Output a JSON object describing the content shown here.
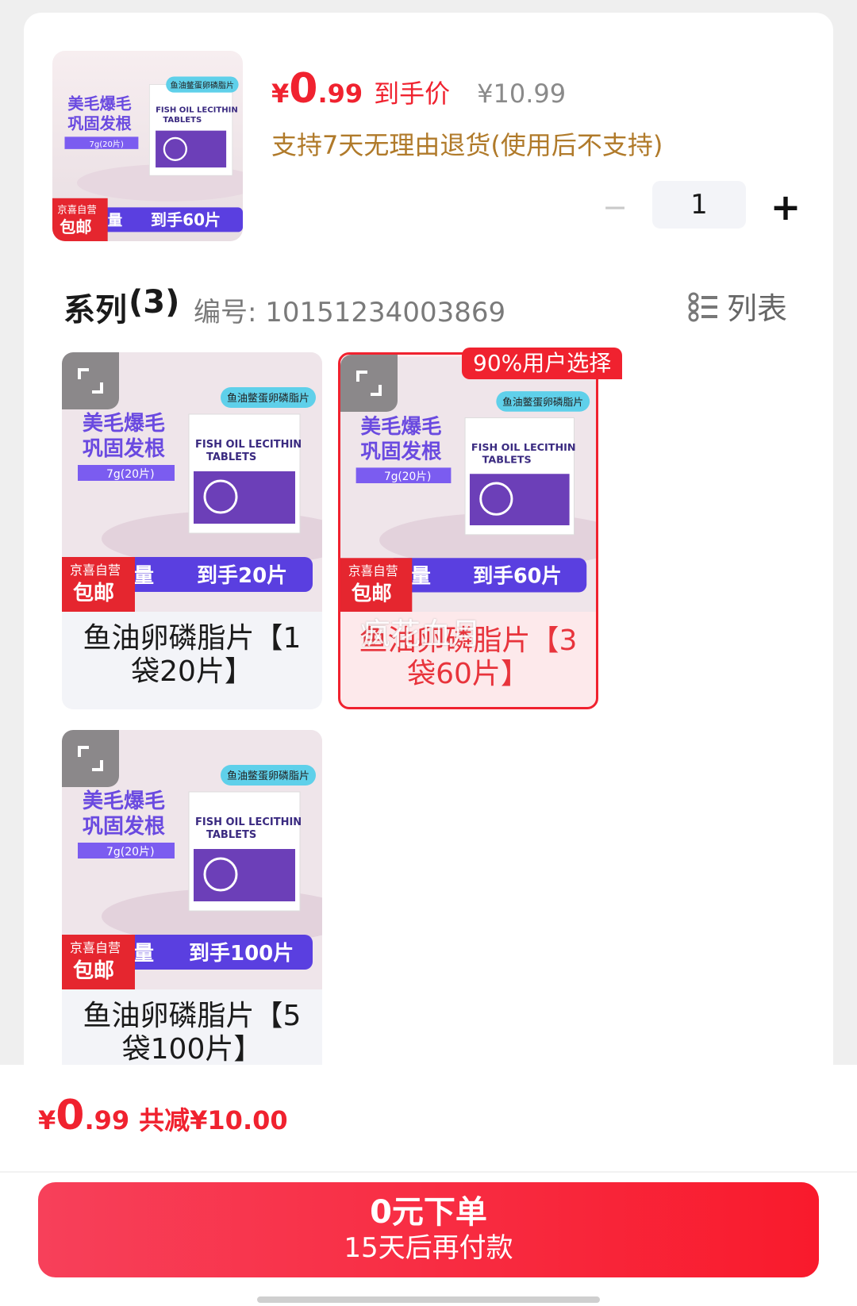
{
  "product": {
    "price_currency": "¥",
    "price_int": "0",
    "price_dec": ".99",
    "price_label": "到手价",
    "original_price": "¥10.99",
    "return_policy": "支持7天无理由退货(使用后不支持)"
  },
  "stepper": {
    "minus": "−",
    "value": "1",
    "plus": "+"
  },
  "series": {
    "title": "系列",
    "count": "(3)",
    "sku_label": "编号: 10151234003869",
    "view_toggle": "列表"
  },
  "image_texts": {
    "tagline_1": "美毛爆毛",
    "tagline_2": "巩固发根",
    "spec": "7g(20片)",
    "pill": "鱼油鳖蛋卵磷脂片",
    "pack_line_1": "FISH OIL LECITHIN",
    "pack_line_2": "TABLETS",
    "badge_top": "京喜自营",
    "badge_bottom": "包邮",
    "band_left": "量"
  },
  "variants": [
    {
      "name": "鱼油卵磷脂片【1袋20片】",
      "band": "到手20片",
      "selected": false
    },
    {
      "name": "鱼油卵磷脂片【3袋60片】",
      "band": "到手60片",
      "selected": true
    },
    {
      "name": "鱼油卵磷脂片【5袋100片】",
      "band": "到手100片",
      "selected": false
    }
  ],
  "header_band": "到手60片",
  "hot_badge": "90%用户选择",
  "watermark": "疯花血月",
  "bottom_bar": {
    "currency": "¥",
    "price_int": "0",
    "price_dec": ".99",
    "saved": "共减¥10.00",
    "order_main": "0元下单",
    "order_sub": "15天后再付款"
  },
  "colors": {
    "accent": "#f0222f",
    "gold": "#b07a2a",
    "purple": "#6a4ae0"
  }
}
